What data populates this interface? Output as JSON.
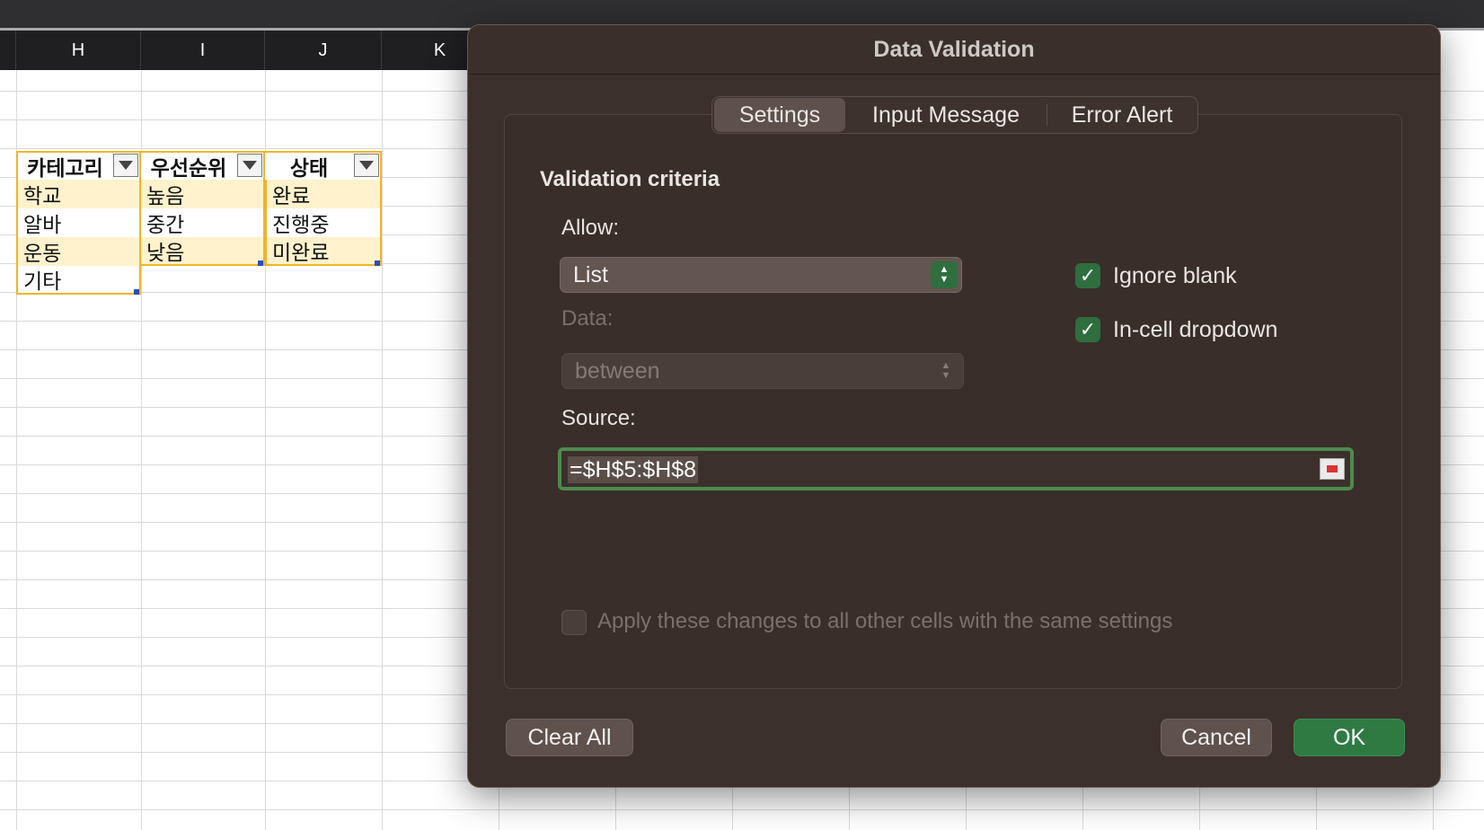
{
  "spreadsheet": {
    "columns": [
      "H",
      "I",
      "J",
      "K"
    ],
    "headers": [
      "카테고리",
      "우선순위",
      "상태"
    ],
    "col_h": [
      "학교",
      "알바",
      "운동",
      "기타"
    ],
    "col_i": [
      "높음",
      "중간",
      "낮음"
    ],
    "col_j": [
      "완료",
      "진행중",
      "미완료"
    ],
    "header_fill": "#fff2cc",
    "border_color": "#f0b429"
  },
  "dialog": {
    "title": "Data Validation",
    "tabs": [
      "Settings",
      "Input Message",
      "Error Alert"
    ],
    "active_tab": "Settings",
    "criteria_heading": "Validation criteria",
    "allow_label": "Allow:",
    "allow_value": "List",
    "data_label": "Data:",
    "data_value": "between",
    "source_label": "Source:",
    "source_value": "=$H$5:$H$8",
    "ignore_blank": {
      "label": "Ignore blank",
      "checked": true
    },
    "in_cell_dropdown": {
      "label": "In-cell dropdown",
      "checked": true
    },
    "apply_all": {
      "label": "Apply these changes to all other cells with the same settings",
      "checked": false
    },
    "buttons": {
      "clear_all": "Clear All",
      "cancel": "Cancel",
      "ok": "OK"
    },
    "accent_color": "#2f7a43"
  }
}
